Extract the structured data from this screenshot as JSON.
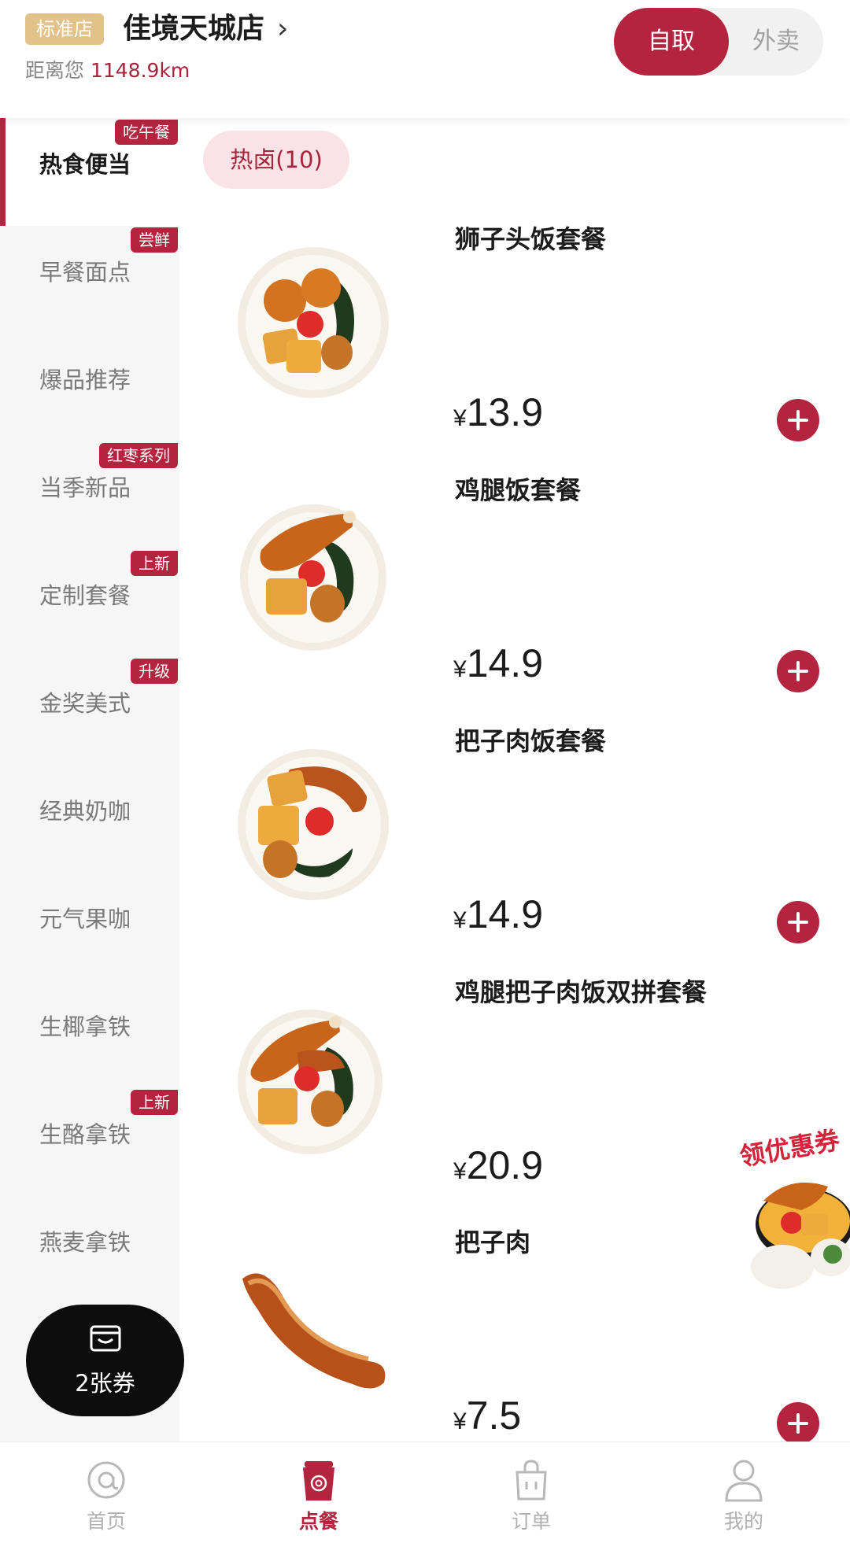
{
  "header": {
    "store_badge": "标准店",
    "store_name": "佳境天城店",
    "store_chevron": "›",
    "distance_prefix": "距离您",
    "distance_value": "1148.9km",
    "mode": {
      "pickup": "自取",
      "delivery": "外卖",
      "selected": "自取"
    }
  },
  "sidebar": {
    "items": [
      {
        "label": "热食便当",
        "tag": "吃午餐",
        "active": true
      },
      {
        "label": "早餐面点",
        "tag": "尝鲜"
      },
      {
        "label": "爆品推荐",
        "tag": ""
      },
      {
        "label": "当季新品",
        "tag": "红枣系列"
      },
      {
        "label": "定制套餐",
        "tag": "上新"
      },
      {
        "label": "金奖美式",
        "tag": "升级"
      },
      {
        "label": "经典奶咖",
        "tag": ""
      },
      {
        "label": "元气果咖",
        "tag": ""
      },
      {
        "label": "生椰拿铁",
        "tag": ""
      },
      {
        "label": "生酪拿铁",
        "tag": "上新"
      },
      {
        "label": "燕麦拿铁",
        "tag": ""
      }
    ]
  },
  "content": {
    "subcategory": "热卤(10)",
    "products": [
      {
        "name": "狮子头饭套餐",
        "currency": "¥",
        "price": "13.9",
        "image": "lion-head-rice-set"
      },
      {
        "name": "鸡腿饭套餐",
        "currency": "¥",
        "price": "14.9",
        "image": "chicken-leg-rice-set"
      },
      {
        "name": "把子肉饭套餐",
        "currency": "¥",
        "price": "14.9",
        "image": "braised-pork-rice-set"
      },
      {
        "name": "鸡腿把子肉饭双拼套餐",
        "currency": "¥",
        "price": "20.9",
        "image": "chicken-pork-combo-set"
      },
      {
        "name": "把子肉",
        "currency": "¥",
        "price": "7.5",
        "image": "braised-pork-strip"
      }
    ],
    "coupon_float": "领优惠券",
    "voucher": {
      "label": "2张券",
      "icon": "wallet-icon"
    }
  },
  "bottom_nav": {
    "items": [
      {
        "label": "首页",
        "icon": "at-sign-icon"
      },
      {
        "label": "点餐",
        "icon": "coffee-cup-icon",
        "active": true
      },
      {
        "label": "订单",
        "icon": "shopping-bag-icon"
      },
      {
        "label": "我的",
        "icon": "person-icon"
      }
    ]
  },
  "colors": {
    "accent": "#b5243e",
    "badge": "#e3c28a",
    "chip_bg": "#f9e3e6",
    "sidebar_bg": "#f6f6f6"
  }
}
